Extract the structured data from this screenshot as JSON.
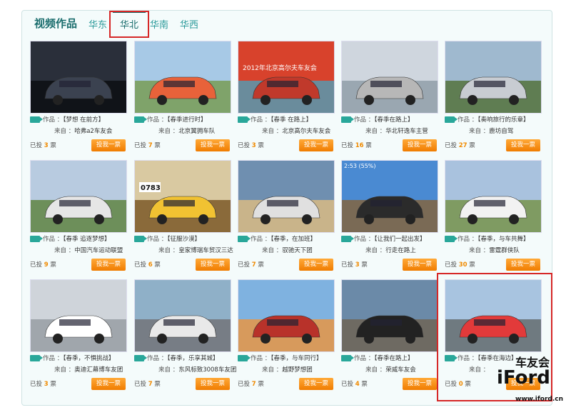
{
  "header": {
    "title": "视频作品",
    "tabs": [
      {
        "label": "华东"
      },
      {
        "label": "华北"
      },
      {
        "label": "华南"
      },
      {
        "label": "华西"
      }
    ]
  },
  "labels": {
    "work": "作品 ：",
    "from": "来自 ：",
    "voted_prefix": "已投",
    "voted_suffix": "票",
    "vote_button": "投我一票"
  },
  "cards": [
    {
      "work": "【梦想 在前方】",
      "from": "哈弗a2车友会",
      "votes": "3"
    },
    {
      "work": "【春季进行时】",
      "from": "北京翼拥车队",
      "votes": "7"
    },
    {
      "work": "【春季 在路上】",
      "from": "北京高尔夫车友会",
      "votes": "3"
    },
    {
      "work": "【春季在路上】",
      "from": "华北轩逸车主营",
      "votes": "16"
    },
    {
      "work": "【奏响旅行的乐章】",
      "from": "鹿坊自驾",
      "votes": "27"
    },
    {
      "work": "【春季 追逐梦想】",
      "from": "中国汽车运动联盟",
      "votes": "9"
    },
    {
      "work": "【征服沙漠】",
      "from": "皇家博瑞车贸汉三达",
      "votes": "6"
    },
    {
      "work": "【春季，在加班】",
      "from": "驭驰天下团",
      "votes": "7"
    },
    {
      "work": "【让我们一起出发】",
      "from": "行走在路上",
      "votes": "3"
    },
    {
      "work": "【春季，与车共舞】",
      "from": "雷霆群侠队",
      "votes": "30"
    },
    {
      "work": "【春季，不惧挑战】",
      "from": "奥迪汇幕博车友团",
      "votes": "3"
    },
    {
      "work": "【春季，乐享其城】",
      "from": "东风标致3008车友团",
      "votes": "7"
    },
    {
      "work": "【春季，与车同行】",
      "from": "越野梦想团",
      "votes": "7"
    },
    {
      "work": "【春季在路上】",
      "from": "荣威车友会",
      "votes": "4"
    },
    {
      "work": "【春季在海边】",
      "from": "",
      "votes": "0"
    }
  ],
  "thumb_texts": {
    "banner": "2012年北京高尔夫车友会",
    "plate": "0783",
    "timestamp": "2:53 (55%)"
  },
  "watermark": {
    "club": "车友会",
    "word": "iFord",
    "url": "www.iford.cn"
  },
  "colors": {
    "accent": "#1a6d6d",
    "tab": "#2b9a9a",
    "vote_button": "#f08a00",
    "highlight_box": "#d62727"
  }
}
